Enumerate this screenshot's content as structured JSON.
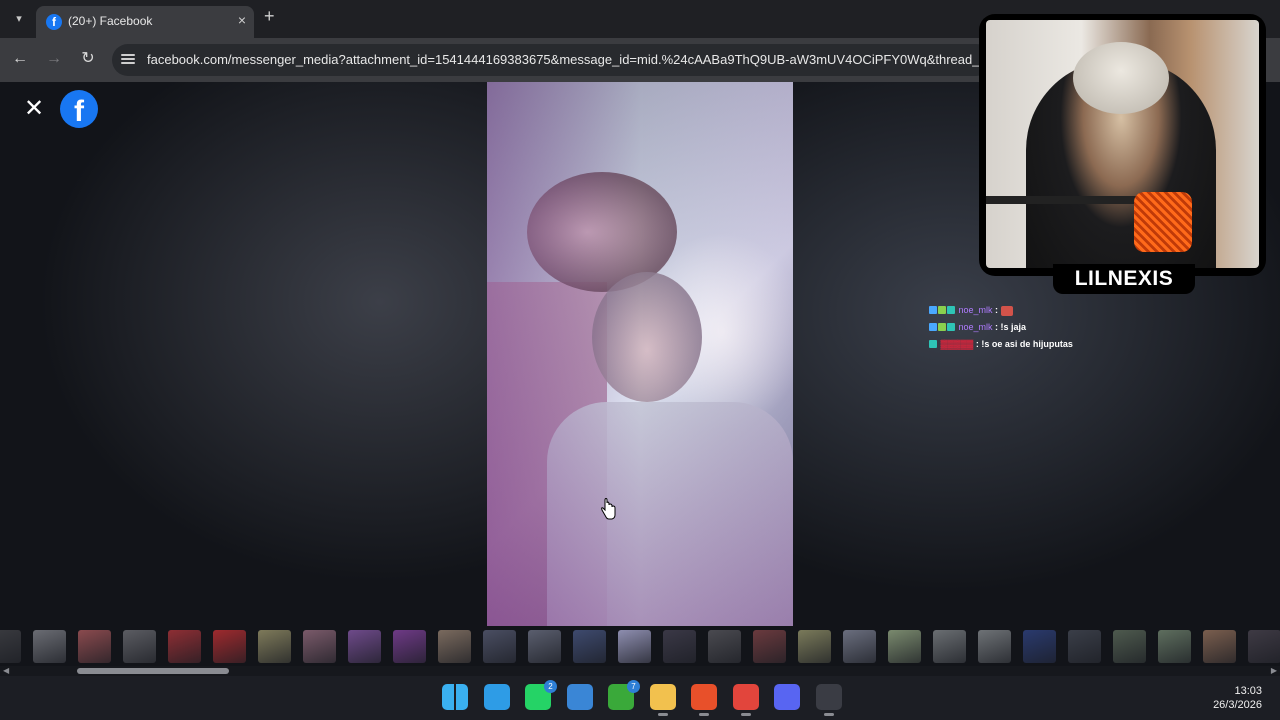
{
  "browser": {
    "tab": {
      "title": "(20+) Facebook",
      "favicon": "f"
    },
    "tab_list_icon": "chevron-down-icon",
    "new_tab_icon": "+",
    "close_tab_icon": "×",
    "url": "facebook.com/messenger_media?attachment_id=1541444169383675&message_id=mid.%24cAABa9ThQ9UB-aW3mUV4OCiPFY0Wq&thread_id=",
    "nav": {
      "back": "←",
      "forward": "→",
      "reload": "↻"
    }
  },
  "viewer": {
    "close_icon": "✕",
    "brand_logo_letter": "f",
    "thumbnail_colors": [
      "#3a3b40",
      "#6a6c73",
      "#8a4a4e",
      "#5b5c62",
      "#8e2e34",
      "#9e2a2e",
      "#7e7a5a",
      "#7a5a6a",
      "#6e4a8a",
      "#6e3a86",
      "#7a6a5e",
      "#4a4e62",
      "#5a5e6e",
      "#3e4a6e",
      "#8e8eb0",
      "#3a3846",
      "#4a4a50",
      "#6a3a3e",
      "#7a7a5a",
      "#6a6e7e",
      "#7a8a6e",
      "#6a6e72",
      "#6e7276",
      "#2a3a6e",
      "#3a3e48",
      "#4e5a4e",
      "#5e6e5e",
      "#7a5e4e",
      "#3e3a44"
    ]
  },
  "overlay": {
    "streamer_name": "LILNEXIS",
    "chat": [
      {
        "user": "noe_mlk",
        "sep": ":",
        "message": "",
        "emote": true,
        "user_color": "#b07cff"
      },
      {
        "user": "noe_mlk",
        "sep": ":",
        "message": "!s jaja",
        "emote": false,
        "user_color": "#b07cff"
      },
      {
        "user": "▓▓▓▓▓",
        "sep": ":",
        "message": "!s oe asi de hijuputas",
        "emote": false,
        "user_color": "#e0243c"
      }
    ]
  },
  "taskbar": {
    "apps": [
      {
        "name": "windows-start",
        "color": "#2e9ce6",
        "badge": ""
      },
      {
        "name": "edge",
        "color": "#2e9ce6",
        "badge": ""
      },
      {
        "name": "whatsapp",
        "color": "#25d366",
        "badge": "2"
      },
      {
        "name": "microsoft-store",
        "color": "#3a86d6",
        "badge": ""
      },
      {
        "name": "xbox",
        "color": "#3aa93a",
        "badge": "7"
      },
      {
        "name": "file-explorer",
        "color": "#f2c14e",
        "badge": ""
      },
      {
        "name": "brave",
        "color": "#e8502a",
        "badge": ""
      },
      {
        "name": "chrome",
        "color": "#e2453c",
        "badge": ""
      },
      {
        "name": "discord",
        "color": "#5865f2",
        "badge": ""
      },
      {
        "name": "obs",
        "color": "#3a3c44",
        "badge": ""
      }
    ],
    "time": "13:03",
    "date": "26/3/2026"
  }
}
